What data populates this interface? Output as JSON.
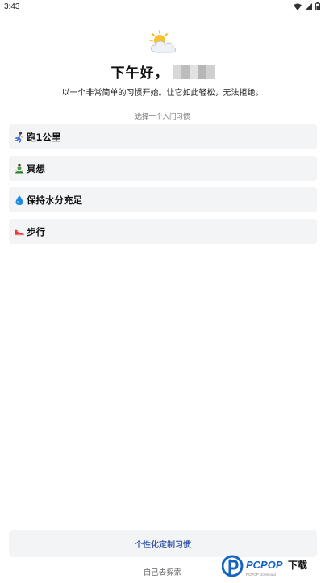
{
  "status_bar": {
    "time": "3:43"
  },
  "header": {
    "greeting": "下午好，",
    "subtitle": "以一个非常简单的习惯开始。让它如此轻松，无法拒绝。"
  },
  "habits": {
    "section_label": "选择一个入门习惯",
    "items": [
      {
        "label": "跑1公里",
        "icon": "runner-icon"
      },
      {
        "label": "冥想",
        "icon": "meditation-icon"
      },
      {
        "label": "保持水分充足",
        "icon": "water-drop-icon"
      },
      {
        "label": "步行",
        "icon": "shoe-icon"
      }
    ]
  },
  "footer": {
    "custom_label": "个性化定制习惯",
    "explore_label": "自己去探索"
  },
  "watermark": {
    "brand": "PCPOP",
    "suffix": "下载",
    "tagline": "PCPOP Download"
  },
  "colors": {
    "accent": "#3a5ba8",
    "card_bg": "#f3f4f6"
  }
}
